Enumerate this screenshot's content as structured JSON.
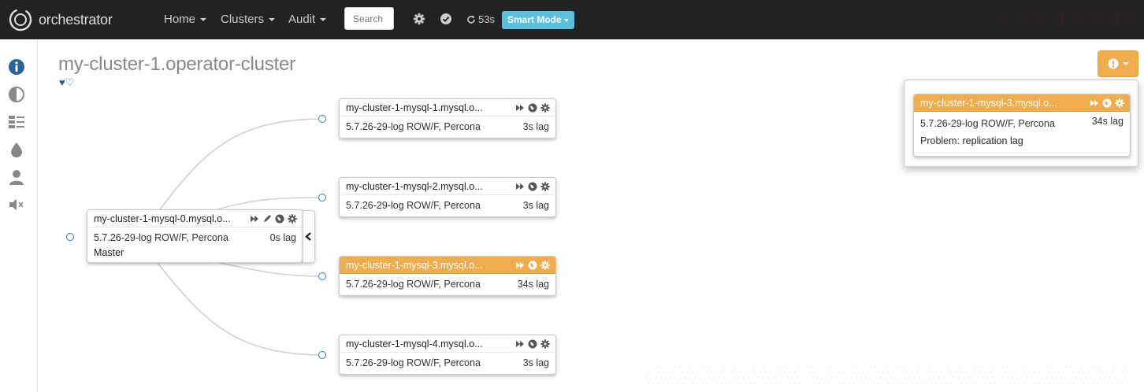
{
  "navbar": {
    "brand": "orchestrator",
    "menus": [
      {
        "label": "Home"
      },
      {
        "label": "Clusters"
      },
      {
        "label": "Audit"
      }
    ],
    "search_placeholder": "Search",
    "refresh_countdown": "53s",
    "smart_mode_label": "Smart Mode"
  },
  "sidebar": {
    "icons": [
      "info-icon",
      "contrast-icon",
      "cluster-list-icon",
      "water-drop-icon",
      "user-icon",
      "mute-icon"
    ]
  },
  "page": {
    "title": "my-cluster-1.operator-cluster",
    "hearts": "♥♡"
  },
  "instances": [
    {
      "name": "my-cluster-1-mysql-0.mysql.o...",
      "version": "5.7.26-29-log ROW/F, Percona",
      "lag": "0s lag",
      "role": "Master",
      "status": "normal"
    },
    {
      "name": "my-cluster-1-mysql-1.mysql.o...",
      "version": "5.7.26-29-log ROW/F, Percona",
      "lag": "3s lag",
      "status": "normal"
    },
    {
      "name": "my-cluster-1-mysql-2.mysql.o...",
      "version": "5.7.26-29-log ROW/F, Percona",
      "lag": "3s lag",
      "status": "normal"
    },
    {
      "name": "my-cluster-1-mysql-3.mysql.o...",
      "version": "5.7.26-29-log ROW/F, Percona",
      "lag": "34s lag",
      "status": "warning"
    },
    {
      "name": "my-cluster-1-mysql-4.mysql.o...",
      "version": "5.7.26-29-log ROW/F, Percona",
      "lag": "3s lag",
      "status": "normal"
    }
  ],
  "problems": {
    "instance_name": "my-cluster-1-mysql-3.mysql.o...",
    "version": "5.7.26-29-log ROW/F, Percona",
    "lag": "34s lag",
    "problem_label": "Problem:",
    "problem_value": "replication lag"
  },
  "colors": {
    "navbar_bg": "#222222",
    "smart_mode": "#5bc0de",
    "warning": "#f0ad4e",
    "accent": "#337ab7"
  }
}
